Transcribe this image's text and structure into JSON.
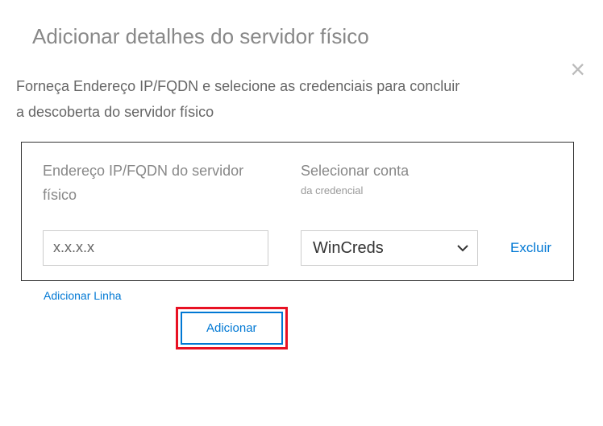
{
  "title": "Adicionar detalhes do servidor físico",
  "description_line1": "Forneça Endereço IP/FQDN e selecione as credenciais para concluir",
  "description_line2": "a descoberta do servidor físico",
  "labels": {
    "ip_fqdn": "Endereço IP/FQDN do servidor físico",
    "select_account": "Selecionar conta",
    "credential_sub": "da credencial"
  },
  "form": {
    "ip_value": "x.x.x.x",
    "select_value": "WinCreds",
    "delete_label": "Excluir"
  },
  "links": {
    "add_line": "Adicionar Linha",
    "add_button": "Adicionar"
  },
  "close_glyph": "×"
}
